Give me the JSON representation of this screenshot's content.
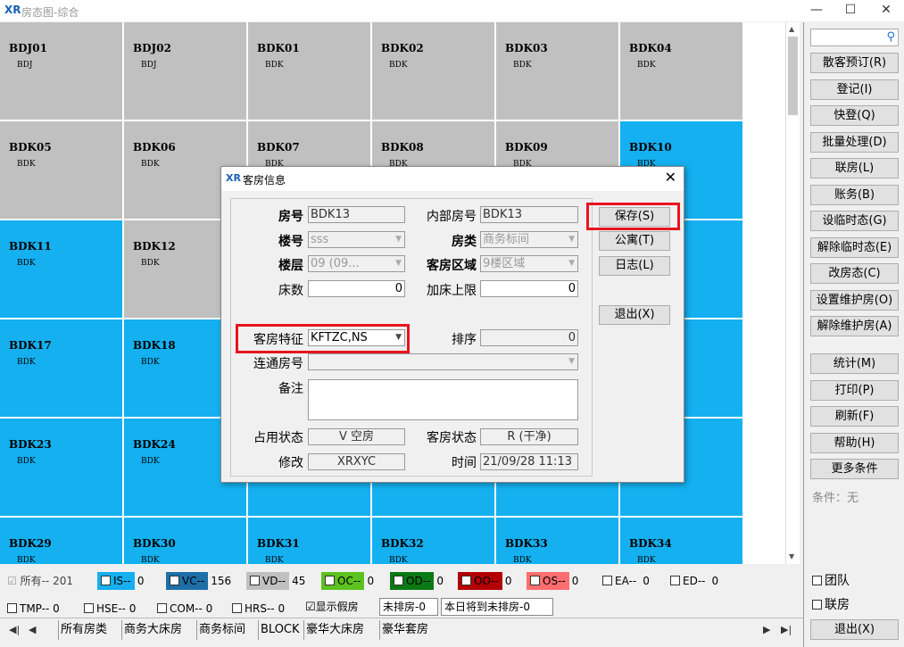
{
  "window": {
    "title": "房态图-综合",
    "logo": "XR",
    "controls": [
      "—",
      "☐",
      "✕"
    ]
  },
  "rooms": [
    {
      "no": "BDJ01",
      "type": "BDJ",
      "color": "gray"
    },
    {
      "no": "BDJ02",
      "type": "BDJ",
      "color": "gray"
    },
    {
      "no": "BDK01",
      "type": "BDK",
      "color": "gray"
    },
    {
      "no": "BDK02",
      "type": "BDK",
      "color": "gray"
    },
    {
      "no": "BDK03",
      "type": "BDK",
      "color": "gray"
    },
    {
      "no": "BDK04",
      "type": "BDK",
      "color": "gray"
    },
    {
      "no": "BDK05",
      "type": "BDK",
      "color": "gray"
    },
    {
      "no": "BDK06",
      "type": "BDK",
      "color": "gray"
    },
    {
      "no": "BDK07",
      "type": "BDK",
      "color": "gray"
    },
    {
      "no": "BDK08",
      "type": "BDK",
      "color": "gray"
    },
    {
      "no": "BDK09",
      "type": "BDK",
      "color": "gray"
    },
    {
      "no": "BDK10",
      "type": "BDK",
      "color": "blue"
    },
    {
      "no": "BDK11",
      "type": "BDK",
      "color": "blue"
    },
    {
      "no": "BDK12",
      "type": "BDK",
      "color": "gray"
    },
    {
      "no": "",
      "type": "",
      "color": "blue"
    },
    {
      "no": "",
      "type": "",
      "color": "blue"
    },
    {
      "no": "",
      "type": "",
      "color": "blue"
    },
    {
      "no": "",
      "type": "",
      "color": "blue"
    },
    {
      "no": "BDK17",
      "type": "BDK",
      "color": "blue"
    },
    {
      "no": "BDK18",
      "type": "BDK",
      "color": "blue"
    },
    {
      "no": "",
      "type": "",
      "color": "blue"
    },
    {
      "no": "",
      "type": "",
      "color": "blue"
    },
    {
      "no": "",
      "type": "",
      "color": "blue"
    },
    {
      "no": "",
      "type": "",
      "color": "blue"
    },
    {
      "no": "BDK23",
      "type": "BDK",
      "color": "blue"
    },
    {
      "no": "BDK24",
      "type": "BDK",
      "color": "blue"
    },
    {
      "no": "",
      "type": "",
      "color": "blue"
    },
    {
      "no": "",
      "type": "",
      "color": "blue"
    },
    {
      "no": "",
      "type": "",
      "color": "blue"
    },
    {
      "no": "",
      "type": "",
      "color": "blue"
    },
    {
      "no": "BDK29",
      "type": "BDK",
      "color": "blue"
    },
    {
      "no": "BDK30",
      "type": "BDK",
      "color": "blue"
    },
    {
      "no": "BDK31",
      "type": "BDK",
      "color": "blue"
    },
    {
      "no": "BDK32",
      "type": "BDK",
      "color": "blue"
    },
    {
      "no": "BDK33",
      "type": "BDK",
      "color": "blue"
    },
    {
      "no": "BDK34",
      "type": "BDK",
      "color": "blue"
    }
  ],
  "colors": {
    "gray": "#c0c0c0",
    "blue": "#14b0f0",
    "highlight": "#e8141e"
  },
  "sidebar": {
    "search_icon": "search-icon",
    "buttons": [
      "散客预订(R)",
      "登记(I)",
      "快登(Q)",
      "批量处理(D)",
      "联房(L)",
      "账务(B)",
      "设临时态(G)",
      "解除临时态(E)",
      "改房态(C)",
      "设置维护房(O)",
      "解除维护房(A)"
    ],
    "buttons2": [
      "统计(M)",
      "打印(P)",
      "刷新(F)",
      "帮助(H)",
      "更多条件"
    ],
    "condition": "条件：无",
    "team_check": "团队",
    "link_check": "联房",
    "exit": "退出(X)"
  },
  "legend": {
    "all": {
      "label": "所有--",
      "count": "201"
    },
    "items": [
      {
        "label": "IS--",
        "count": "0",
        "bg": "#14b0f0",
        "fg": "#000"
      },
      {
        "label": "VC--",
        "count": "156",
        "bg": "#1e6fa8",
        "fg": "#000"
      },
      {
        "label": "VD--",
        "count": "45",
        "bg": "#c0c0c0",
        "fg": "#000"
      },
      {
        "label": "OC--",
        "count": "0",
        "bg": "#5cc21e",
        "fg": "#000"
      },
      {
        "label": "OD--",
        "count": "0",
        "bg": "#0a7a14",
        "fg": "#000"
      },
      {
        "label": "OO--",
        "count": "0",
        "bg": "#b40000",
        "fg": "#000"
      },
      {
        "label": "OS--",
        "count": "0",
        "bg": "#ff6e6e",
        "fg": "#000"
      },
      {
        "label": "EA--",
        "count": "0",
        "bg": "",
        "fg": "#000"
      },
      {
        "label": "ED--",
        "count": "0",
        "bg": "",
        "fg": "#000"
      }
    ],
    "row2": [
      {
        "label": "TMP--",
        "count": "0"
      },
      {
        "label": "HSE--",
        "count": "0"
      },
      {
        "label": "COM--",
        "count": "0"
      },
      {
        "label": "HRS--",
        "count": "0"
      }
    ],
    "show_fake": "显示假房",
    "unassigned": "未排房-0",
    "today_unassigned": "本日将到未排房-0"
  },
  "tabs": [
    "所有房类",
    "商务大床房",
    "商务标间",
    "BLOCK",
    "豪华大床房",
    "豪华套房"
  ],
  "dialog": {
    "title": "客房信息",
    "close": "✕",
    "fields": {
      "room_no_label": "房号",
      "room_no": "BDK13",
      "inner_no_label": "内部房号",
      "inner_no": "BDK13",
      "building_label": "楼号",
      "building": "sss",
      "room_type_label": "房类",
      "room_type": "商务标间",
      "floor_label": "楼层",
      "floor": "09   (09...",
      "area_label": "客房区域",
      "area": "9楼区域",
      "beds_label": "床数",
      "beds": "0",
      "extra_bed_label": "加床上限",
      "extra_bed": "0",
      "feature_label": "客房特征",
      "feature": "KFTZC,NS",
      "sort_label": "排序",
      "sort": "0",
      "connect_label": "连通房号",
      "connect": "",
      "remark_label": "备注",
      "remark": "",
      "occupy_label": "占用状态",
      "occupy": "V   空房",
      "status_label": "客房状态",
      "status": "R   (干净)",
      "modify_label": "修改",
      "modify": "XRXYC",
      "time_label": "时间",
      "time": "21/09/28 11:13"
    },
    "buttons": [
      "保存(S)",
      "公寓(T)",
      "日志(L)",
      "退出(X)"
    ]
  }
}
